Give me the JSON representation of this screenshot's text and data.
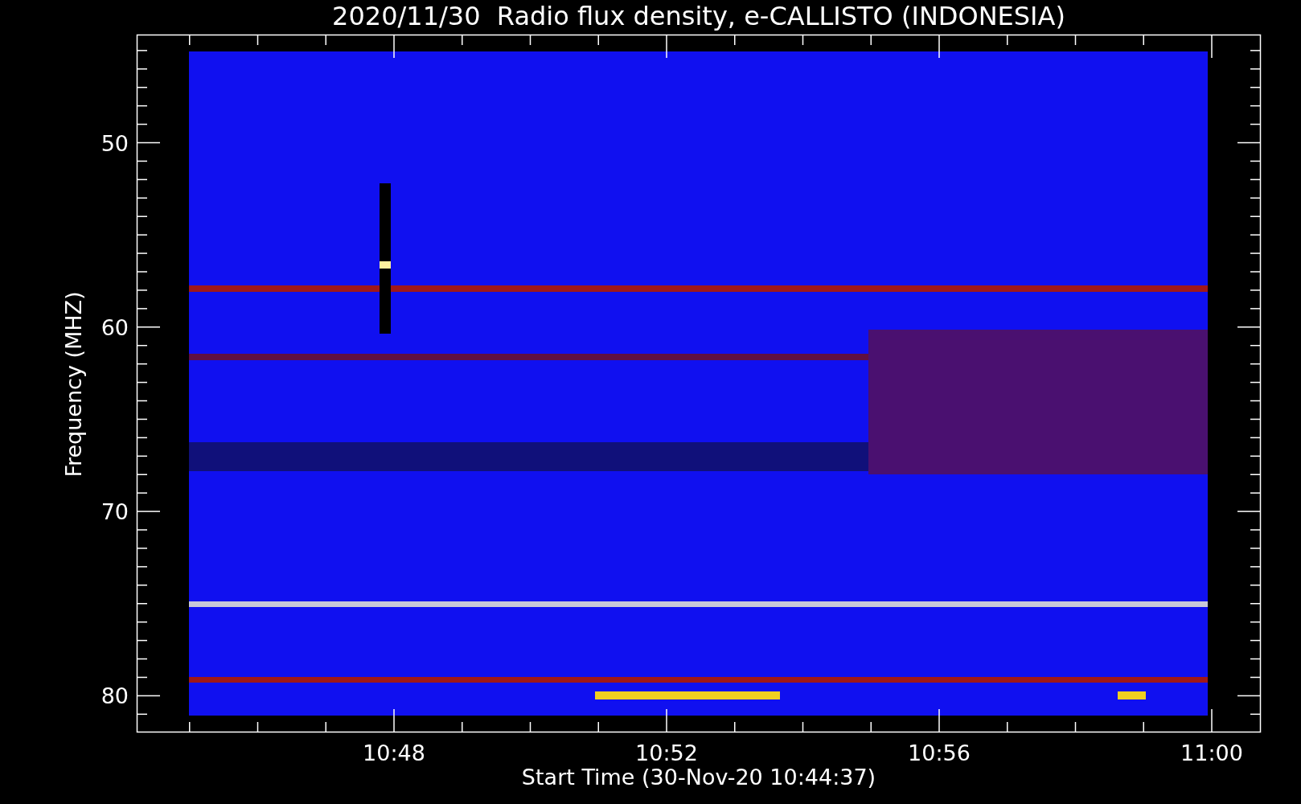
{
  "title": "2020/11/30  Radio flux density, e-CALLISTO (INDONESIA)",
  "y_axis": {
    "label": "Frequency (MHZ)",
    "ticks": [
      "50",
      "60",
      "70",
      "80"
    ]
  },
  "x_axis": {
    "label": "Start Time (30-Nov-20 10:44:37)",
    "ticks": [
      "10:48",
      "10:52",
      "10:56",
      "11:00"
    ]
  }
}
